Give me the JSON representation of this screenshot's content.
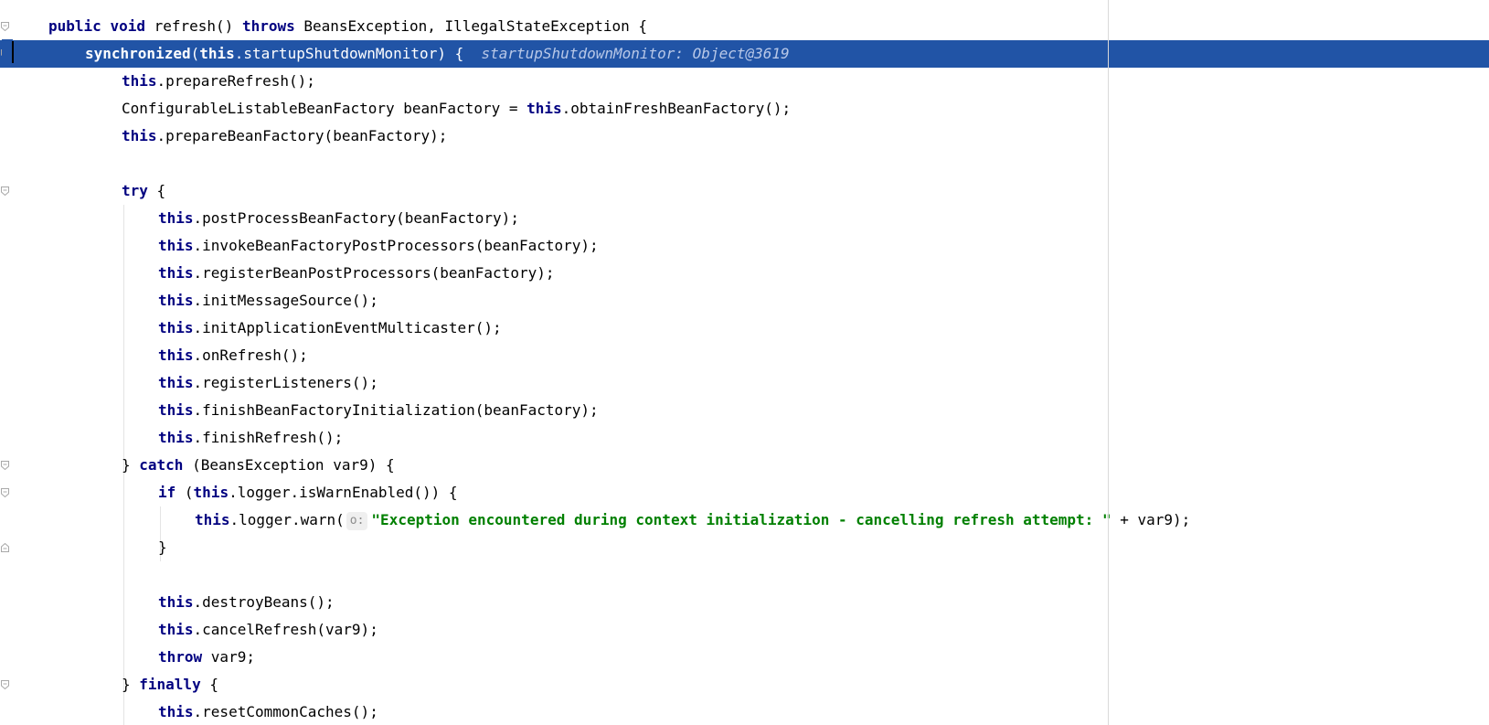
{
  "editor": {
    "lines": [
      {
        "indent": 1,
        "current": false,
        "tokens": [
          {
            "t": "kw",
            "v": "public "
          },
          {
            "t": "kw",
            "v": "void "
          },
          {
            "t": "plain",
            "v": "refresh() "
          },
          {
            "t": "kw",
            "v": "throws "
          },
          {
            "t": "plain",
            "v": "BeansException, IllegalStateException {"
          }
        ]
      },
      {
        "indent": 2,
        "current": true,
        "tokens": [
          {
            "t": "kw",
            "v": "synchronized"
          },
          {
            "t": "plain",
            "v": "("
          },
          {
            "t": "kw",
            "v": "this"
          },
          {
            "t": "plain",
            "v": ".startupShutdownMonitor) {  "
          },
          {
            "t": "hint",
            "v": "startupShutdownMonitor: Object@3619"
          }
        ]
      },
      {
        "indent": 3,
        "current": false,
        "tokens": [
          {
            "t": "kw",
            "v": "this"
          },
          {
            "t": "plain",
            "v": ".prepareRefresh();"
          }
        ]
      },
      {
        "indent": 3,
        "current": false,
        "tokens": [
          {
            "t": "plain",
            "v": "ConfigurableListableBeanFactory beanFactory = "
          },
          {
            "t": "kw",
            "v": "this"
          },
          {
            "t": "plain",
            "v": ".obtainFreshBeanFactory();"
          }
        ]
      },
      {
        "indent": 3,
        "current": false,
        "tokens": [
          {
            "t": "kw",
            "v": "this"
          },
          {
            "t": "plain",
            "v": ".prepareBeanFactory(beanFactory);"
          }
        ]
      },
      {
        "indent": 3,
        "current": false,
        "tokens": []
      },
      {
        "indent": 3,
        "current": false,
        "tokens": [
          {
            "t": "kw",
            "v": "try "
          },
          {
            "t": "plain",
            "v": "{"
          }
        ]
      },
      {
        "indent": 4,
        "current": false,
        "tokens": [
          {
            "t": "kw",
            "v": "this"
          },
          {
            "t": "plain",
            "v": ".postProcessBeanFactory(beanFactory);"
          }
        ]
      },
      {
        "indent": 4,
        "current": false,
        "tokens": [
          {
            "t": "kw",
            "v": "this"
          },
          {
            "t": "plain",
            "v": ".invokeBeanFactoryPostProcessors(beanFactory);"
          }
        ]
      },
      {
        "indent": 4,
        "current": false,
        "tokens": [
          {
            "t": "kw",
            "v": "this"
          },
          {
            "t": "plain",
            "v": ".registerBeanPostProcessors(beanFactory);"
          }
        ]
      },
      {
        "indent": 4,
        "current": false,
        "tokens": [
          {
            "t": "kw",
            "v": "this"
          },
          {
            "t": "plain",
            "v": ".initMessageSource();"
          }
        ]
      },
      {
        "indent": 4,
        "current": false,
        "tokens": [
          {
            "t": "kw",
            "v": "this"
          },
          {
            "t": "plain",
            "v": ".initApplicationEventMulticaster();"
          }
        ]
      },
      {
        "indent": 4,
        "current": false,
        "tokens": [
          {
            "t": "kw",
            "v": "this"
          },
          {
            "t": "plain",
            "v": ".onRefresh();"
          }
        ]
      },
      {
        "indent": 4,
        "current": false,
        "tokens": [
          {
            "t": "kw",
            "v": "this"
          },
          {
            "t": "plain",
            "v": ".registerListeners();"
          }
        ]
      },
      {
        "indent": 4,
        "current": false,
        "tokens": [
          {
            "t": "kw",
            "v": "this"
          },
          {
            "t": "plain",
            "v": ".finishBeanFactoryInitialization(beanFactory);"
          }
        ]
      },
      {
        "indent": 4,
        "current": false,
        "tokens": [
          {
            "t": "kw",
            "v": "this"
          },
          {
            "t": "plain",
            "v": ".finishRefresh();"
          }
        ]
      },
      {
        "indent": 3,
        "current": false,
        "tokens": [
          {
            "t": "plain",
            "v": "} "
          },
          {
            "t": "kw",
            "v": "catch "
          },
          {
            "t": "plain",
            "v": "(BeansException var9) {"
          }
        ]
      },
      {
        "indent": 4,
        "current": false,
        "tokens": [
          {
            "t": "kw",
            "v": "if "
          },
          {
            "t": "plain",
            "v": "("
          },
          {
            "t": "kw",
            "v": "this"
          },
          {
            "t": "plain",
            "v": ".logger.isWarnEnabled()) {"
          }
        ]
      },
      {
        "indent": 5,
        "current": false,
        "tokens": [
          {
            "t": "kw",
            "v": "this"
          },
          {
            "t": "plain",
            "v": ".logger.warn("
          },
          {
            "t": "param",
            "v": "o:"
          },
          {
            "t": "str",
            "v": "\"Exception encountered during context initialization - cancelling refresh attempt: \""
          },
          {
            "t": "plain",
            "v": " + var9);"
          }
        ]
      },
      {
        "indent": 4,
        "current": false,
        "tokens": [
          {
            "t": "plain",
            "v": "}"
          }
        ]
      },
      {
        "indent": 4,
        "current": false,
        "tokens": []
      },
      {
        "indent": 4,
        "current": false,
        "tokens": [
          {
            "t": "kw",
            "v": "this"
          },
          {
            "t": "plain",
            "v": ".destroyBeans();"
          }
        ]
      },
      {
        "indent": 4,
        "current": false,
        "tokens": [
          {
            "t": "kw",
            "v": "this"
          },
          {
            "t": "plain",
            "v": ".cancelRefresh(var9);"
          }
        ]
      },
      {
        "indent": 4,
        "current": false,
        "tokens": [
          {
            "t": "kw",
            "v": "throw "
          },
          {
            "t": "plain",
            "v": "var9;"
          }
        ]
      },
      {
        "indent": 3,
        "current": false,
        "tokens": [
          {
            "t": "plain",
            "v": "} "
          },
          {
            "t": "kw",
            "v": "finally "
          },
          {
            "t": "plain",
            "v": "{"
          }
        ]
      },
      {
        "indent": 4,
        "current": false,
        "tokens": [
          {
            "t": "kw",
            "v": "this"
          },
          {
            "t": "plain",
            "v": ".resetCommonCaches();"
          }
        ]
      }
    ]
  },
  "colors": {
    "keyword": "#000080",
    "string": "#008000",
    "selection": "#2154a6",
    "hint": "#8c8c8c"
  }
}
